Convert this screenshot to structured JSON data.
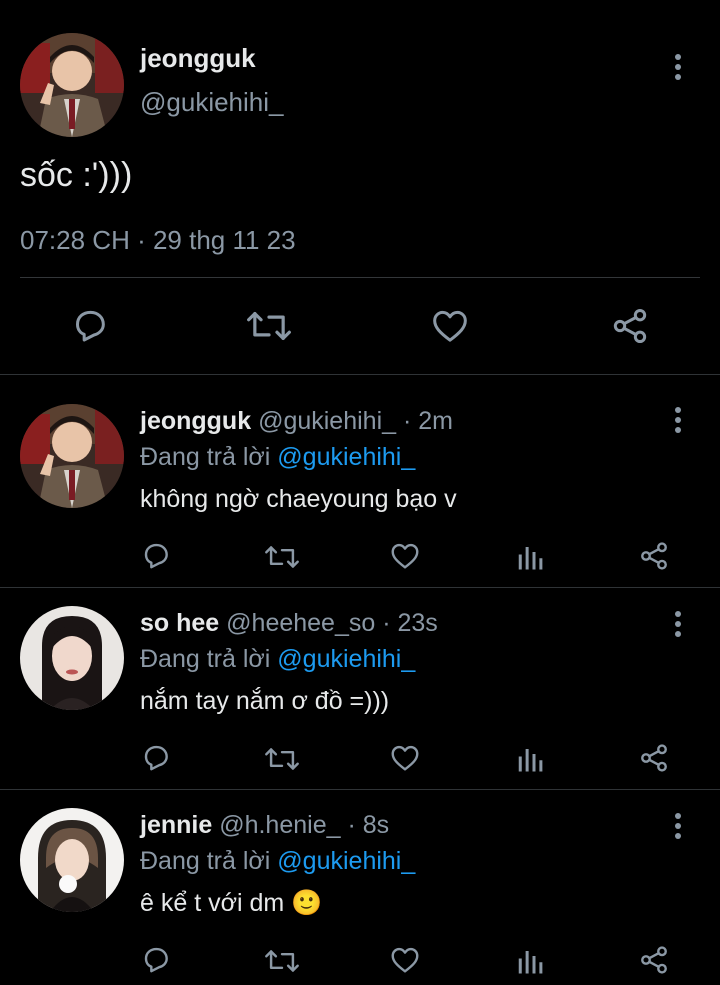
{
  "main_tweet": {
    "author_name": "jeongguk",
    "author_handle": "@gukiehihi_",
    "text": "sốc :')))",
    "timestamp": "07:28 CH · 29 thg 11 23"
  },
  "replies": [
    {
      "name": "jeongguk",
      "handle": "@gukiehihi_",
      "time": "· 2m",
      "replying_prefix": "Đang trả lời",
      "replying_to": "@gukiehihi_",
      "text": "không ngờ chaeyoung bạo v"
    },
    {
      "name": "so hee",
      "handle": "@heehee_so",
      "time": "· 23s",
      "replying_prefix": "Đang trả lời",
      "replying_to": "@gukiehihi_",
      "text": "nắm tay nắm ơ đồ =)))"
    },
    {
      "name": "jennie",
      "handle": "@h.henie_",
      "time": "· 8s",
      "replying_prefix": "Đang trả lời",
      "replying_to": "@gukiehihi_",
      "text": "ê kể t với dm 🙂"
    }
  ],
  "icons": {
    "reply": "reply-icon",
    "retweet": "retweet-icon",
    "like": "like-icon",
    "views": "views-icon",
    "share": "share-icon",
    "more": "more-vertical-icon"
  },
  "colors": {
    "background": "#000000",
    "text": "#e7e9ea",
    "muted": "#8b98a5",
    "link": "#1d9bf0",
    "divider": "#2f3336"
  }
}
